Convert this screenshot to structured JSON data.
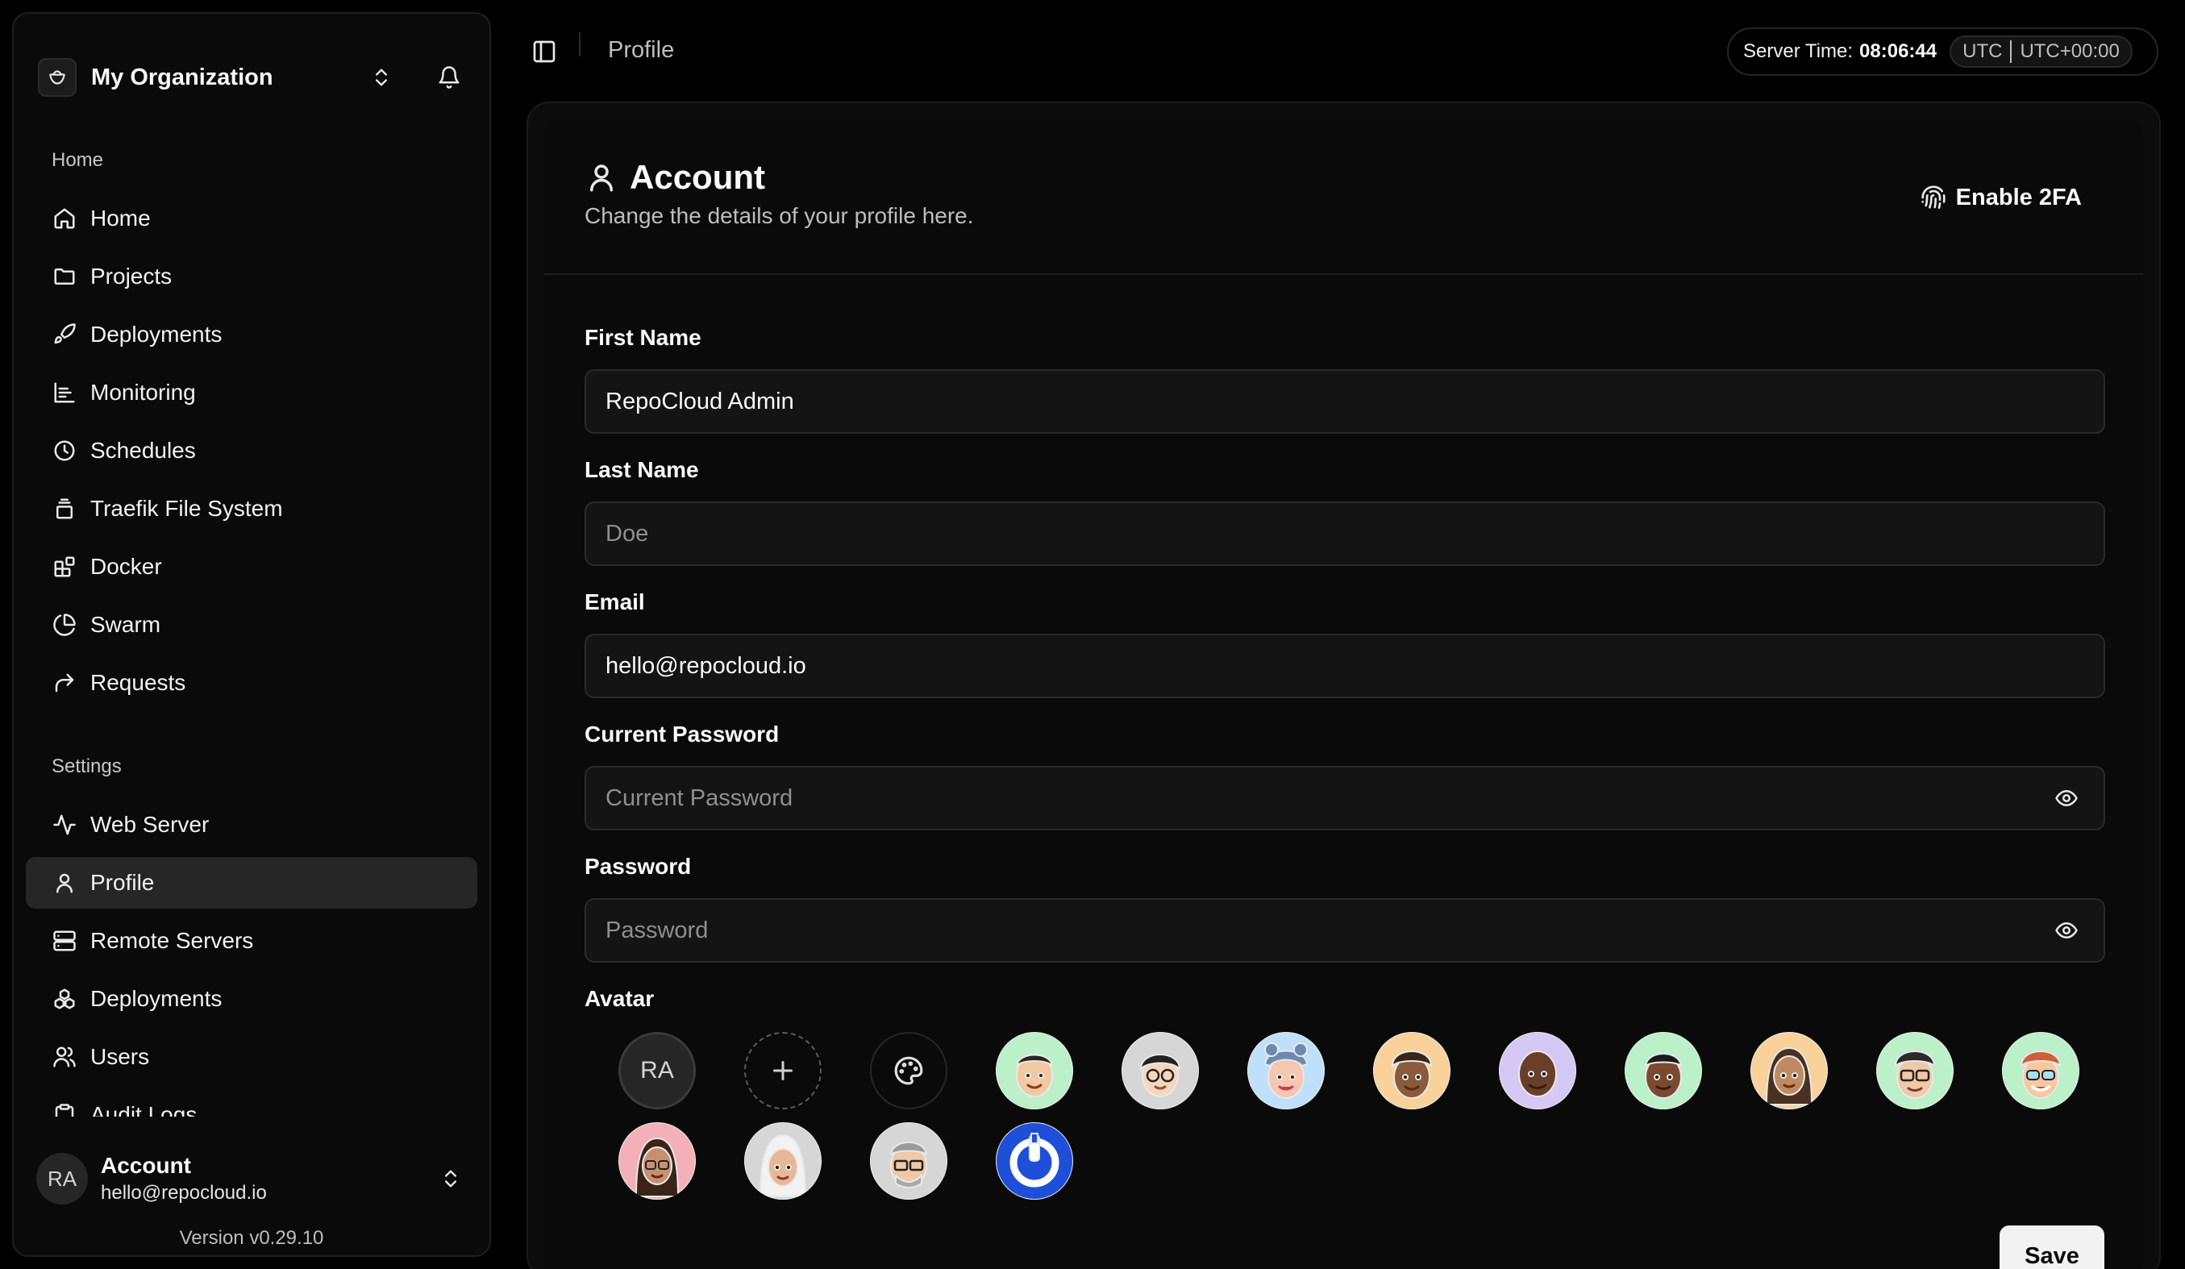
{
  "sidebar": {
    "org_name": "My Organization",
    "groups": [
      {
        "label": "Home",
        "items": [
          {
            "label": "Home",
            "icon": "home-icon"
          },
          {
            "label": "Projects",
            "icon": "folder-icon"
          },
          {
            "label": "Deployments",
            "icon": "rocket-icon"
          },
          {
            "label": "Monitoring",
            "icon": "chart-icon"
          },
          {
            "label": "Schedules",
            "icon": "clock-icon"
          },
          {
            "label": "Traefik File System",
            "icon": "layers-icon"
          },
          {
            "label": "Docker",
            "icon": "blocks-icon"
          },
          {
            "label": "Swarm",
            "icon": "pie-icon"
          },
          {
            "label": "Requests",
            "icon": "forward-arrow-icon"
          }
        ]
      },
      {
        "label": "Settings",
        "items": [
          {
            "label": "Web Server",
            "icon": "activity-icon"
          },
          {
            "label": "Profile",
            "icon": "user-icon",
            "active": true
          },
          {
            "label": "Remote Servers",
            "icon": "server-icon"
          },
          {
            "label": "Deployments",
            "icon": "boxes-icon"
          },
          {
            "label": "Users",
            "icon": "users-icon"
          },
          {
            "label": "Audit Logs",
            "icon": "clipboard-icon"
          }
        ]
      }
    ],
    "user": {
      "initials": "RA",
      "name": "Account",
      "email": "hello@repocloud.io"
    },
    "version": "Version v0.29.10"
  },
  "topbar": {
    "breadcrumb": "Profile",
    "server_time_label": "Server Time:",
    "server_time_value": "08:06:44",
    "tz_name": "UTC",
    "tz_offset": "UTC+00:00"
  },
  "account": {
    "title": "Account",
    "description": "Change the details of your profile here.",
    "enable_2fa": "Enable 2FA",
    "first_name_label": "First Name",
    "first_name_value": "RepoCloud Admin",
    "last_name_label": "Last Name",
    "last_name_placeholder": "Doe",
    "email_label": "Email",
    "email_value": "hello@repocloud.io",
    "current_password_label": "Current Password",
    "current_password_placeholder": "Current Password",
    "password_label": "Password",
    "password_placeholder": "Password",
    "avatar_label": "Avatar",
    "avatar_initials": "RA",
    "save_label": "Save"
  },
  "colors": {
    "background": "#000000",
    "card": "#0a0a0a",
    "active_nav": "#262626",
    "primary_button": "#f2f2f2"
  }
}
